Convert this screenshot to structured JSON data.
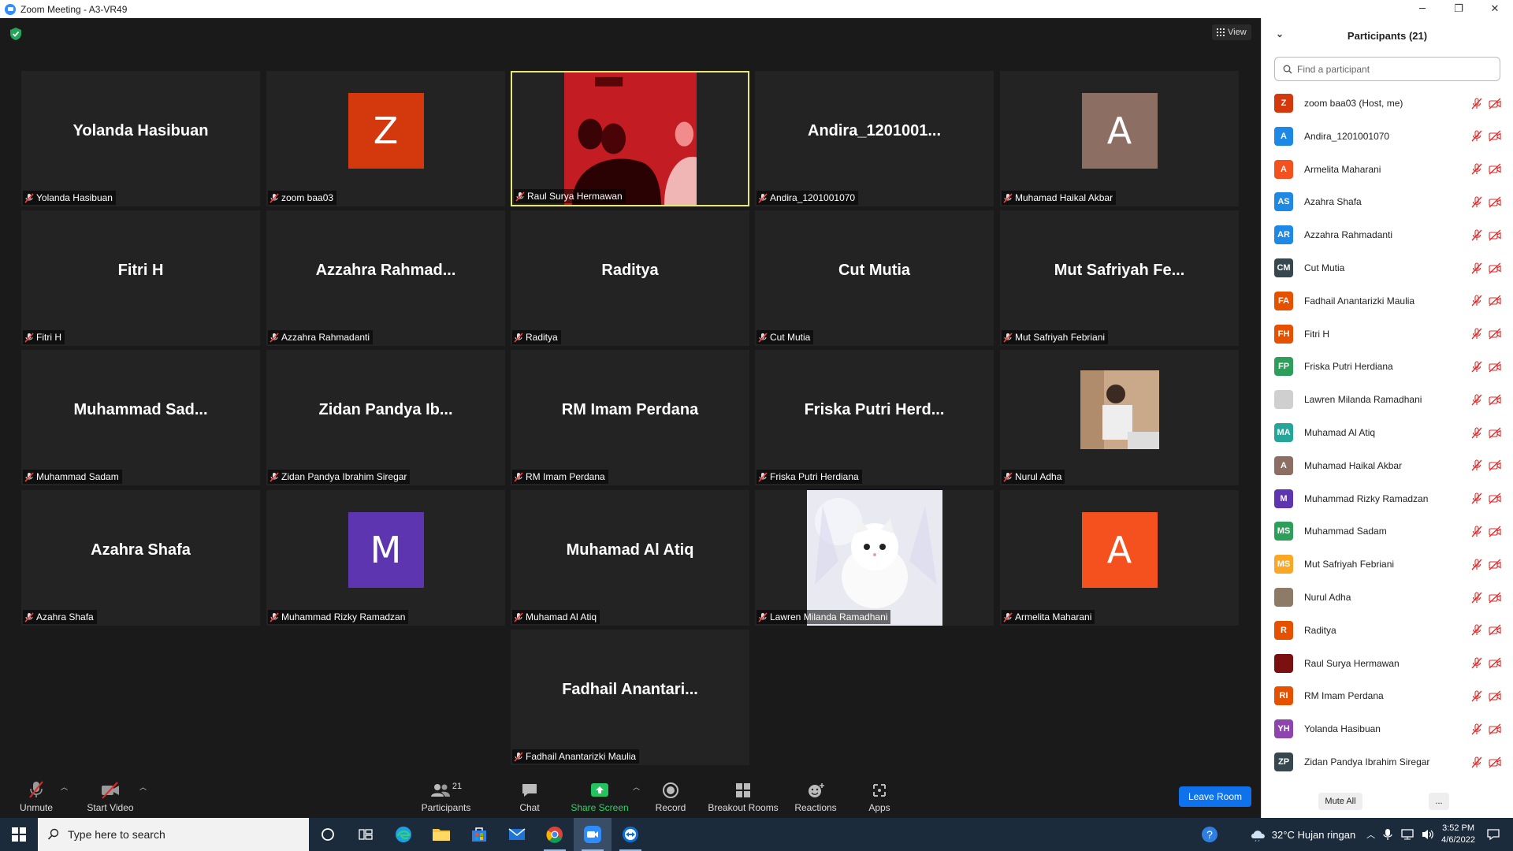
{
  "window": {
    "title": "Zoom Meeting - A3-VR49",
    "minimize": "─",
    "maximize": "❐",
    "close": "✕"
  },
  "meeting": {
    "view_label": "View",
    "tiles": [
      {
        "big": "Yolanda Hasibuan",
        "label": "Yolanda Hasibuan",
        "type": "name"
      },
      {
        "big": "Z",
        "label": "zoom baa03",
        "type": "avatar",
        "color": "#d4380d"
      },
      {
        "big": "",
        "label": "Raul Surya Hermawan",
        "type": "video",
        "active": true
      },
      {
        "big": "Andira_1201001...",
        "label": "Andira_1201001070",
        "type": "name"
      },
      {
        "big": "A",
        "label": "Muhamad Haikal Akbar",
        "type": "avatar",
        "color": "#8d6e63"
      },
      {
        "big": "Fitri H",
        "label": "Fitri H",
        "type": "name"
      },
      {
        "big": "Azzahra  Rahmad...",
        "label": "Azzahra Rahmadanti",
        "type": "name"
      },
      {
        "big": "Raditya",
        "label": "Raditya",
        "type": "name"
      },
      {
        "big": "Cut Mutia",
        "label": "Cut Mutia",
        "type": "name"
      },
      {
        "big": "Mut  Safriyah  Fe...",
        "label": "Mut Safriyah Febriani",
        "type": "name"
      },
      {
        "big": "Muhammad  Sad...",
        "label": "Muhammad Sadam",
        "type": "name"
      },
      {
        "big": "Zidan  Pandya  Ib...",
        "label": "Zidan Pandya Ibrahim Siregar",
        "type": "name"
      },
      {
        "big": "RM Imam Perdana",
        "label": "RM Imam Perdana",
        "type": "name"
      },
      {
        "big": "Friska  Putri  Herd...",
        "label": "Friska Putri Herdiana",
        "type": "name"
      },
      {
        "big": "",
        "label": "Nurul Adha",
        "type": "photo"
      },
      {
        "big": "Azahra Shafa",
        "label": "Azahra Shafa",
        "type": "name"
      },
      {
        "big": "M",
        "label": "Muhammad Rizky Ramadzan",
        "type": "avatar",
        "color": "#5e35b1"
      },
      {
        "big": "Muhamad Al Atiq",
        "label": "Muhamad Al Atiq",
        "type": "name"
      },
      {
        "big": "",
        "label": "Lawren Milanda Ramadhani",
        "type": "cat"
      },
      {
        "big": "A",
        "label": "Armelita Maharani",
        "type": "avatar",
        "color": "#f4511e"
      },
      {
        "big": "Fadhail  Anantari...",
        "label": "Fadhail Anantarizki Maulia",
        "type": "name"
      }
    ]
  },
  "toolbar": {
    "unmute": "Unmute",
    "start_video": "Start Video",
    "participants": "Participants",
    "participants_count": "21",
    "chat": "Chat",
    "share_screen": "Share Screen",
    "record": "Record",
    "breakout_rooms": "Breakout Rooms",
    "reactions": "Reactions",
    "apps": "Apps",
    "leave_room": "Leave Room"
  },
  "panel": {
    "title": "Participants (21)",
    "search_placeholder": "Find a participant",
    "mute_all": "Mute All",
    "more": "...",
    "participants": [
      {
        "initials": "Z",
        "name": "zoom baa03 (Host, me)",
        "color": "#d4380d"
      },
      {
        "initials": "A",
        "name": "Andira_1201001070",
        "color": "#1e88e5"
      },
      {
        "initials": "A",
        "name": "Armelita Maharani",
        "color": "#f4511e"
      },
      {
        "initials": "AS",
        "name": "Azahra Shafa",
        "color": "#1e88e5"
      },
      {
        "initials": "AR",
        "name": "Azzahra Rahmadanti",
        "color": "#1e88e5"
      },
      {
        "initials": "CM",
        "name": "Cut Mutia",
        "color": "#37474f"
      },
      {
        "initials": "FA",
        "name": "Fadhail Anantarizki Maulia",
        "color": "#e65100"
      },
      {
        "initials": "FH",
        "name": "Fitri H",
        "color": "#e65100"
      },
      {
        "initials": "FP",
        "name": "Friska Putri Herdiana",
        "color": "#2e9e5b"
      },
      {
        "initials": "",
        "name": "Lawren Milanda Ramadhani",
        "color": "#cfcfcf"
      },
      {
        "initials": "MA",
        "name": "Muhamad Al Atiq",
        "color": "#26a69a"
      },
      {
        "initials": "A",
        "name": "Muhamad Haikal Akbar",
        "color": "#8d6e63"
      },
      {
        "initials": "M",
        "name": "Muhammad Rizky Ramadzan",
        "color": "#5e35b1"
      },
      {
        "initials": "MS",
        "name": "Muhammad Sadam",
        "color": "#2e9e5b"
      },
      {
        "initials": "MS",
        "name": "Mut Safriyah Febriani",
        "color": "#f9a825"
      },
      {
        "initials": "",
        "name": "Nurul Adha",
        "color": "#8d7b68"
      },
      {
        "initials": "R",
        "name": "Raditya",
        "color": "#e65100"
      },
      {
        "initials": "",
        "name": "Raul Surya Hermawan",
        "color": "#7a1010"
      },
      {
        "initials": "RI",
        "name": "RM Imam Perdana",
        "color": "#e65100"
      },
      {
        "initials": "YH",
        "name": "Yolanda Hasibuan",
        "color": "#8e44ad"
      },
      {
        "initials": "ZP",
        "name": "Zidan Pandya Ibrahim Siregar",
        "color": "#37474f"
      }
    ]
  },
  "taskbar": {
    "search_placeholder": "Type here to search",
    "weather": "32°C  Hujan ringan",
    "time": "3:52 PM",
    "date": "4/6/2022"
  }
}
